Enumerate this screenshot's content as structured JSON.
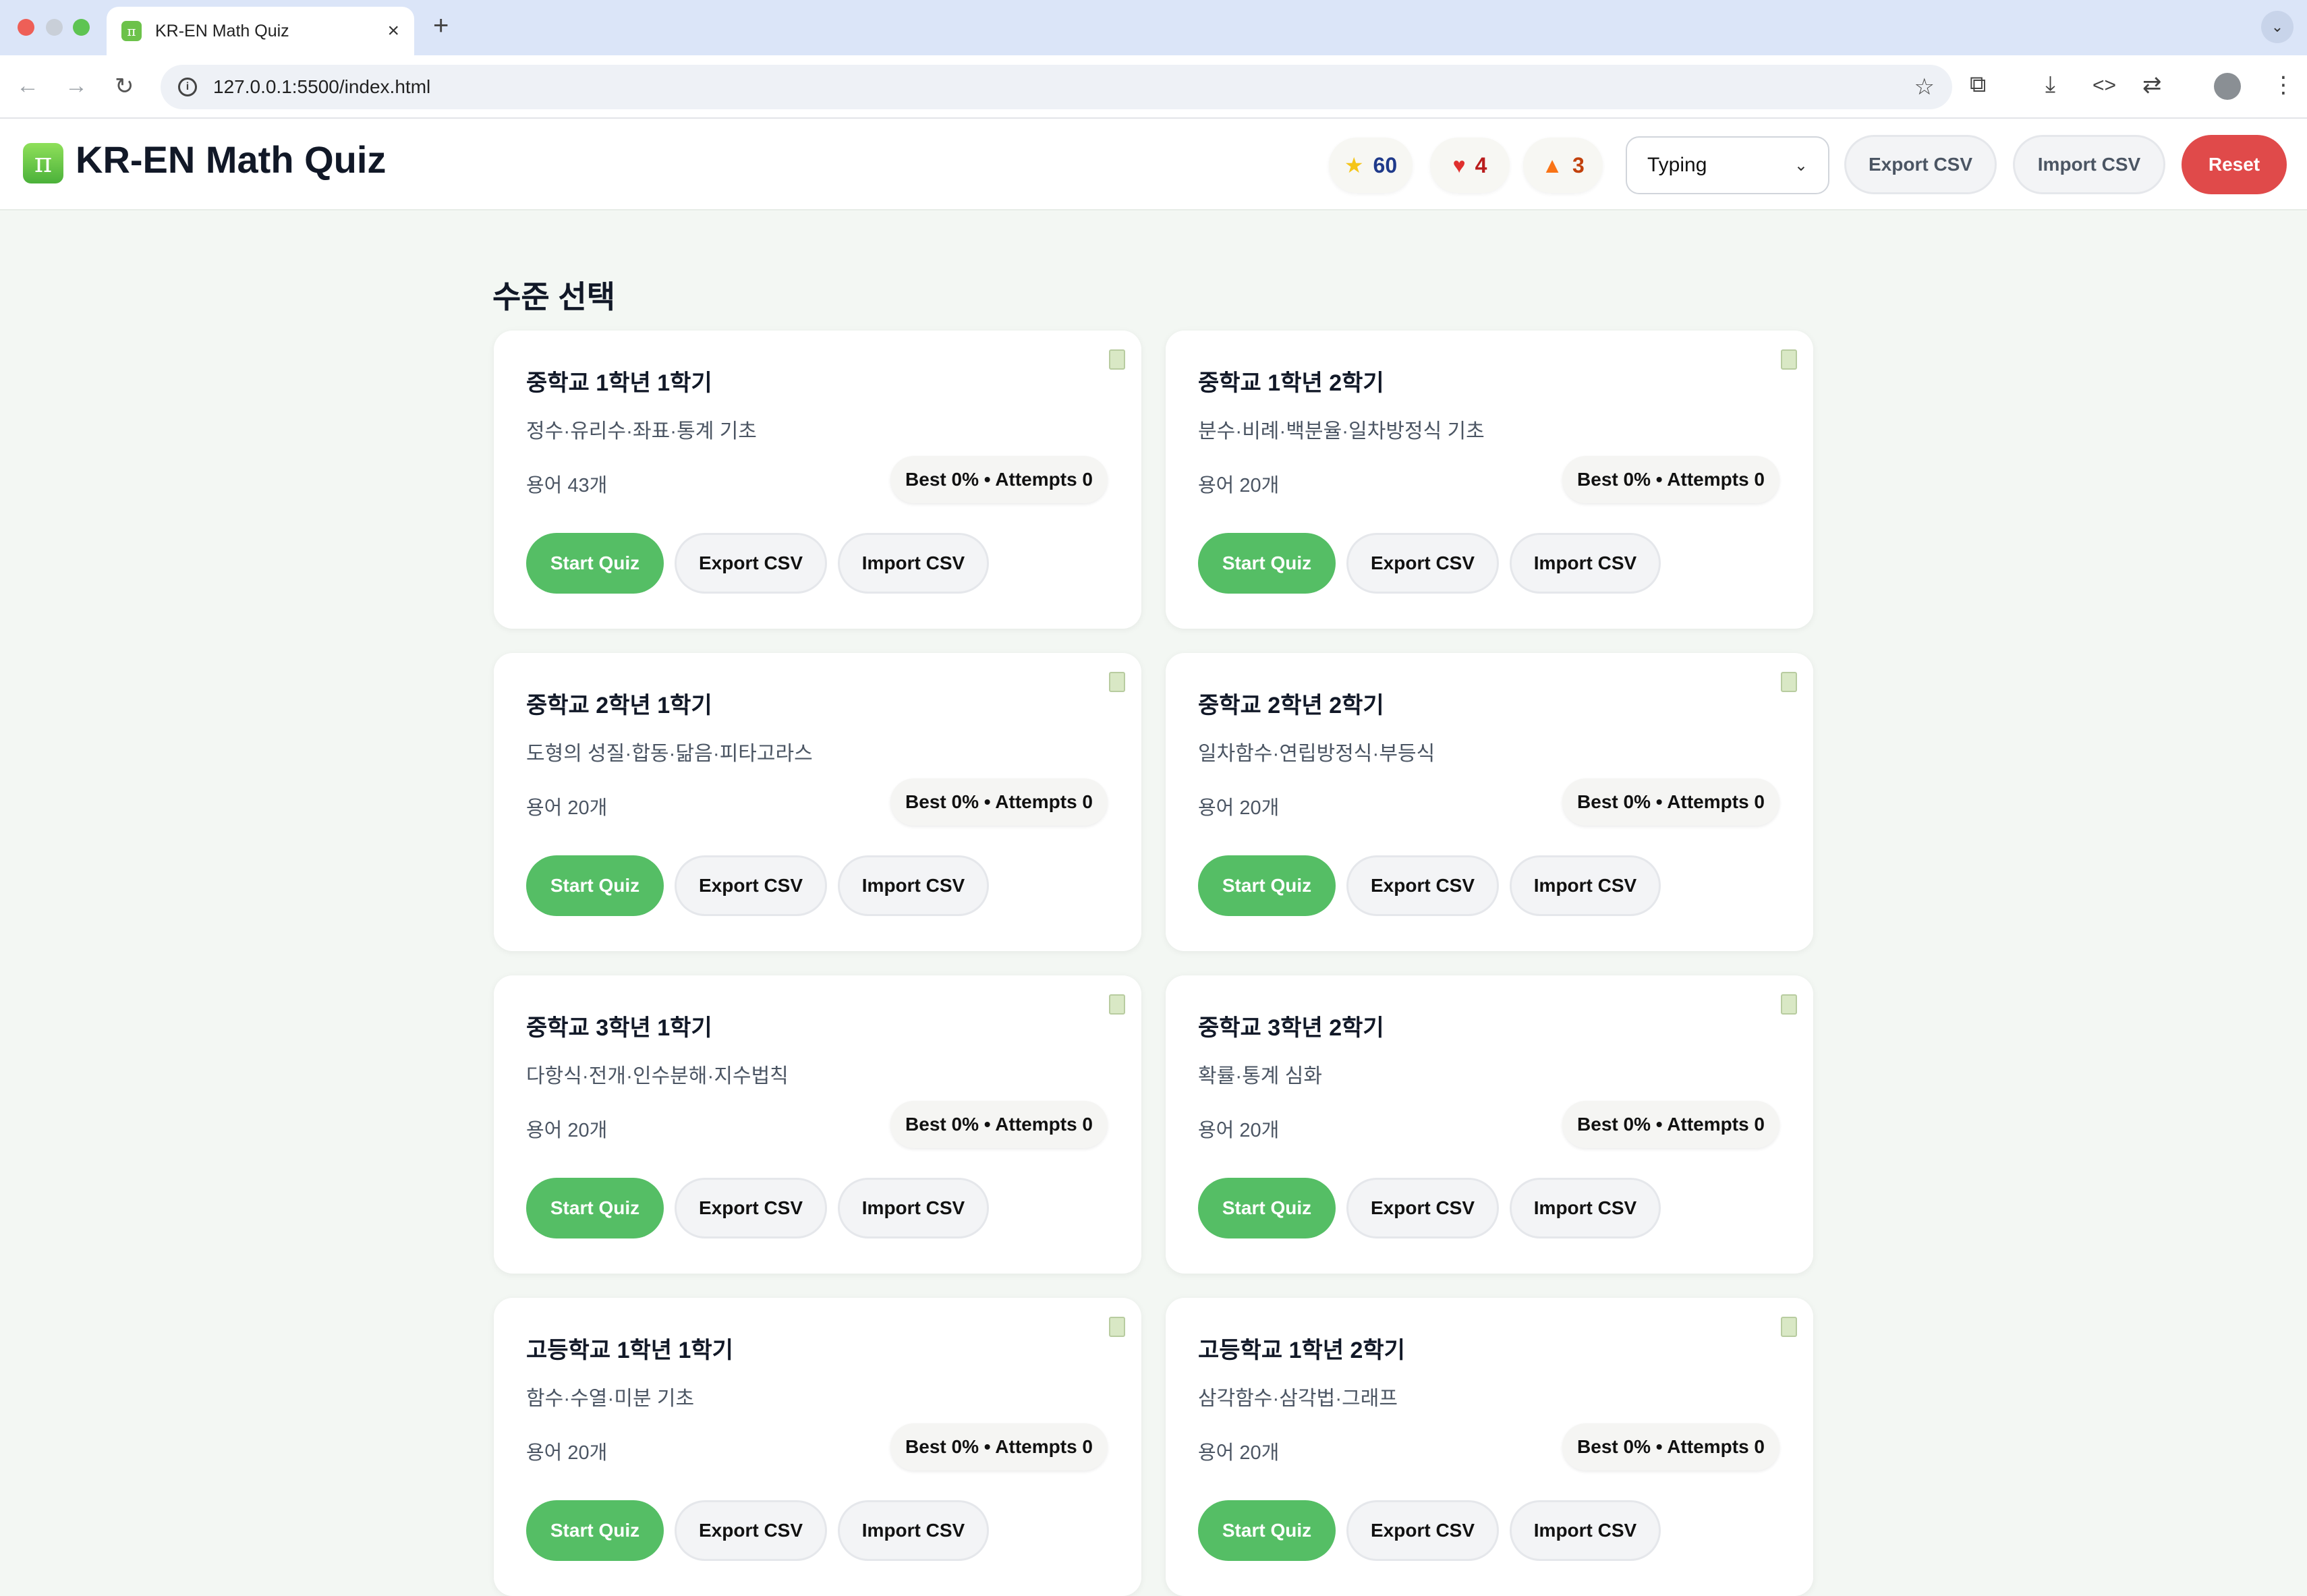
{
  "browser": {
    "tab_title": "KR-EN Math Quiz",
    "tab_icon": "π",
    "url": "127.0.0.1:5500/index.html"
  },
  "header": {
    "title": "KR-EN Math Quiz",
    "logo_glyph": "π",
    "stats": {
      "stars": "60",
      "hearts": "4",
      "streak": "3"
    },
    "mode": "Typing",
    "export_label": "Export CSV",
    "import_label": "Import CSV",
    "reset_label": "Reset"
  },
  "section_title": "수준 선택",
  "card_buttons": {
    "start": "Start Quiz",
    "export": "Export CSV",
    "import": "Import CSV"
  },
  "levels": [
    {
      "title": "중학교 1학년 1학기",
      "subtitle": "정수·유리수·좌표·통계 기초",
      "terms": "용어 43개",
      "stats": "Best 0% • Attempts 0"
    },
    {
      "title": "중학교 1학년 2학기",
      "subtitle": "분수·비례·백분율·일차방정식 기초",
      "terms": "용어 20개",
      "stats": "Best 0% • Attempts 0"
    },
    {
      "title": "중학교 2학년 1학기",
      "subtitle": "도형의 성질·합동·닮음·피타고라스",
      "terms": "용어 20개",
      "stats": "Best 0% • Attempts 0"
    },
    {
      "title": "중학교 2학년 2학기",
      "subtitle": "일차함수·연립방정식·부등식",
      "terms": "용어 20개",
      "stats": "Best 0% • Attempts 0"
    },
    {
      "title": "중학교 3학년 1학기",
      "subtitle": "다항식·전개·인수분해·지수법칙",
      "terms": "용어 20개",
      "stats": "Best 0% • Attempts 0"
    },
    {
      "title": "중학교 3학년 2학기",
      "subtitle": "확률·통계 심화",
      "terms": "용어 20개",
      "stats": "Best 0% • Attempts 0"
    },
    {
      "title": "고등학교 1학년 1학기",
      "subtitle": "함수·수열·미분 기초",
      "terms": "용어 20개",
      "stats": "Best 0% • Attempts 0"
    },
    {
      "title": "고등학교 1학년 2학기",
      "subtitle": "삼각함수·삼각법·그래프",
      "terms": "용어 20개",
      "stats": "Best 0% • Attempts 0"
    }
  ]
}
